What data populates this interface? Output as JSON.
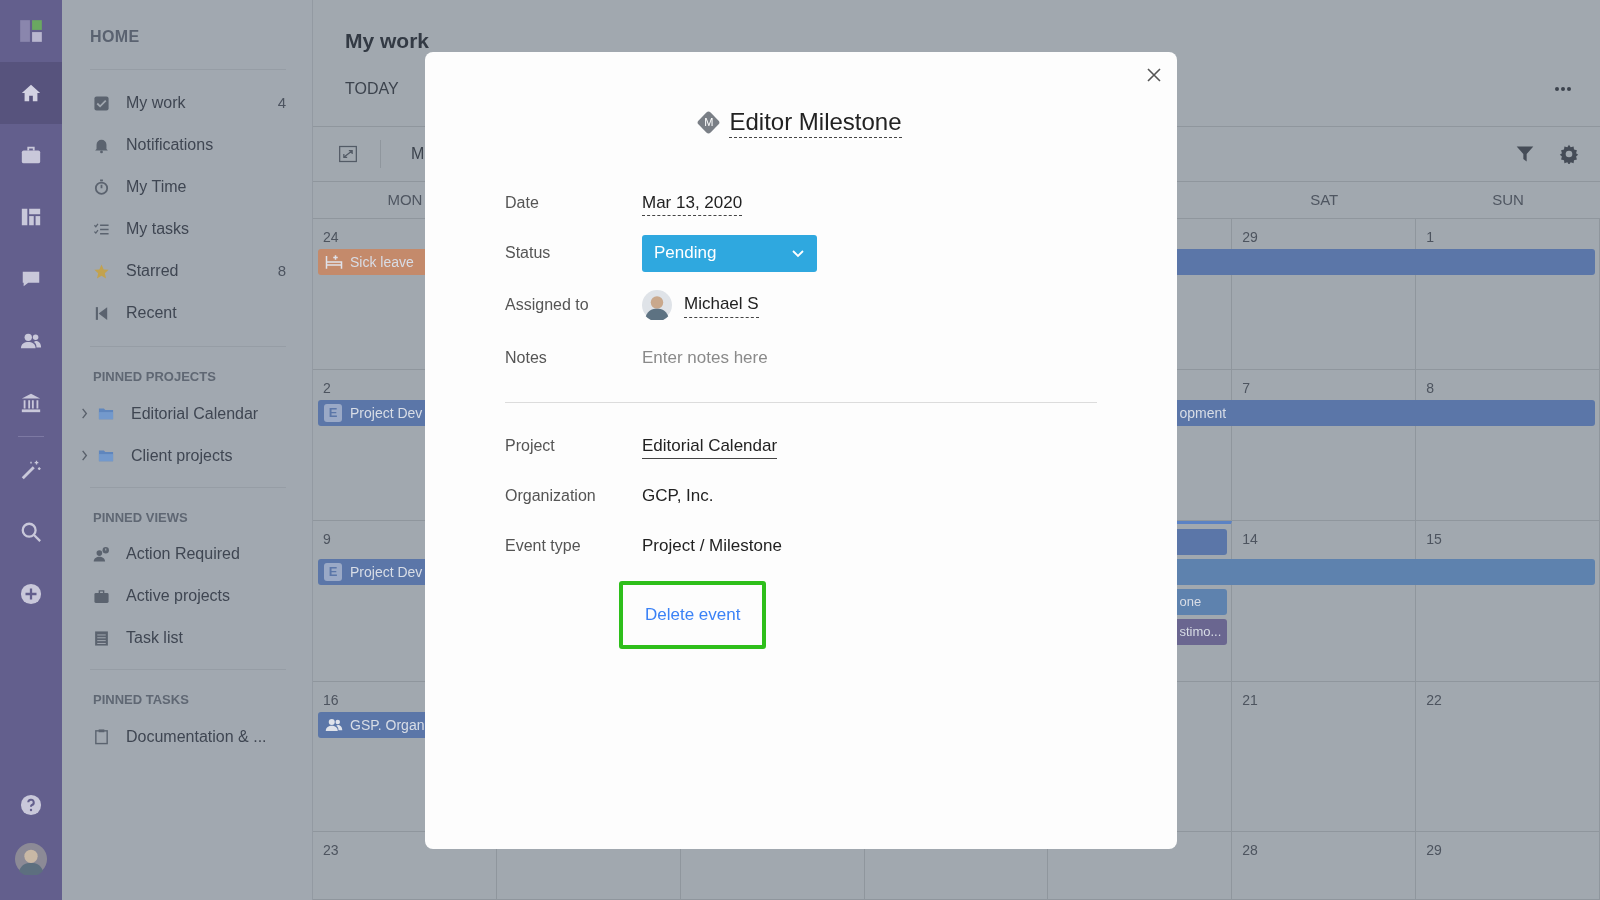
{
  "rail": [
    {
      "kind": "home",
      "selected": true
    },
    {
      "kind": "briefcase",
      "selected": false
    },
    {
      "kind": "board",
      "selected": false
    },
    {
      "kind": "chat",
      "selected": false
    },
    {
      "kind": "people",
      "selected": false
    },
    {
      "kind": "bank",
      "selected": false
    },
    {
      "kind": "wand",
      "selected": false
    },
    {
      "kind": "search",
      "selected": false
    },
    {
      "kind": "plus",
      "selected": false
    }
  ],
  "rail_bottom": [
    {
      "kind": "help"
    },
    {
      "kind": "avatar"
    }
  ],
  "nav": {
    "heading": "HOME",
    "items": [
      {
        "kind": "check",
        "label": "My work",
        "count": "4"
      },
      {
        "kind": "bell",
        "label": "Notifications"
      },
      {
        "kind": "timer",
        "label": "My Time"
      },
      {
        "kind": "checklist",
        "label": "My tasks"
      },
      {
        "kind": "star",
        "label": "Starred",
        "count": "8"
      },
      {
        "kind": "back",
        "label": "Recent"
      }
    ],
    "sections": [
      {
        "title": "PINNED PROJECTS",
        "items": [
          {
            "kind": "folder",
            "label": "Editorial Calendar",
            "collapsed": true
          },
          {
            "kind": "folder",
            "label": "Client projects",
            "collapsed": true
          }
        ]
      },
      {
        "title": "PINNED VIEWS",
        "items": [
          {
            "kind": "alert",
            "label": "Action Required"
          },
          {
            "kind": "briefcase",
            "label": "Active projects"
          },
          {
            "kind": "list",
            "label": "Task list"
          }
        ]
      },
      {
        "title": "PINNED TASKS",
        "items": [
          {
            "kind": "clipboard",
            "label": "Documentation & ..."
          }
        ]
      }
    ]
  },
  "main": {
    "title": "My work",
    "tabs": [
      {
        "label": "TODAY",
        "selected": false
      }
    ],
    "view_label": "M",
    "calendar": {
      "weekdays": {
        "mon": "MON",
        "sat": "SAT",
        "sun": "SUN"
      },
      "weeks": [
        {
          "today": false,
          "dates": {
            "mon": "24",
            "sat": "29",
            "sun": "1"
          },
          "events": [
            {
              "kind": "leave",
              "label": "Sick leave",
              "color": "#c48a6b"
            },
            {
              "kind": "tailwide",
              "color": "#5b76a8"
            }
          ]
        },
        {
          "today": false,
          "dates": {
            "mon": "2",
            "sat": "7",
            "sun": "8"
          },
          "events": [
            {
              "kind": "project",
              "label": "Project Dev",
              "color": "#5b76a8",
              "badge": "E"
            },
            {
              "kind": "tailwide",
              "label": "opment",
              "color": "#5b76a8"
            }
          ]
        },
        {
          "today": true,
          "dates": {
            "mon": "9",
            "sat": "14",
            "sun": "15"
          },
          "events": [
            {
              "kind": "project",
              "label": "Project Dev",
              "color": "#5b76a8",
              "badge": "E"
            },
            {
              "kind": "tail",
              "color": "#5b76a8"
            },
            {
              "kind": "tailwide",
              "color": "#5e82ae"
            },
            {
              "kind": "tail",
              "label": "one",
              "color": "#5e82ae"
            },
            {
              "kind": "tail",
              "label": "stimo...",
              "color": "#6a6690"
            }
          ]
        },
        {
          "today": false,
          "dates": {
            "mon": "16",
            "sat": "21",
            "sun": "22"
          },
          "events": [
            {
              "kind": "meeting",
              "label": "GSP. Organ",
              "color": "#5b76a8"
            }
          ]
        },
        {
          "today": false,
          "dates": {
            "mon": "23",
            "sat": "28",
            "sun": "29"
          }
        }
      ]
    }
  },
  "modal": {
    "title": "Editor Milestone",
    "title_badge": "M",
    "fields": [
      {
        "kind": "date",
        "label": "Date",
        "value": "Mar 13, 2020"
      },
      {
        "kind": "status",
        "label": "Status",
        "value": "Pending"
      },
      {
        "kind": "person",
        "label": "Assigned to",
        "value": "Michael S"
      },
      {
        "kind": "notes",
        "label": "Notes",
        "placeholder": "Enter notes here"
      },
      {
        "kind": "divider"
      },
      {
        "kind": "link",
        "label": "Project",
        "value": "Editorial Calendar"
      },
      {
        "kind": "text",
        "label": "Organization",
        "value": "GCP, Inc."
      },
      {
        "kind": "text",
        "label": "Event type",
        "value": "Project / Milestone"
      }
    ],
    "delete": {
      "label": "Delete event",
      "highlighted": true
    }
  }
}
